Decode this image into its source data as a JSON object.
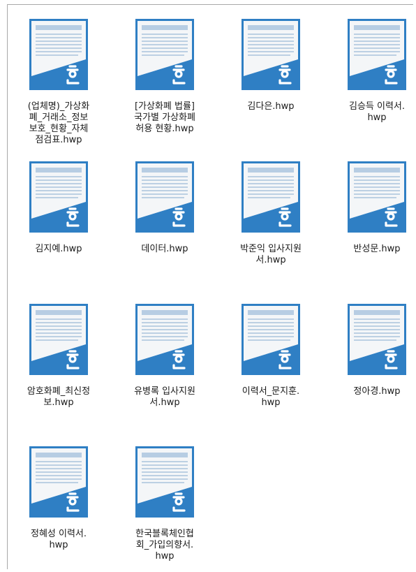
{
  "files": [
    {
      "name": "(업체명)_가상화\n폐_거래소_정보\n보호_현황_자체\n점검표.hwp",
      "icon": "hwp-document-icon"
    },
    {
      "name": "[가상화폐 법률]\n국가별 가상화폐\n허용 현황.hwp",
      "icon": "hwp-document-icon"
    },
    {
      "name": "김다은.hwp",
      "icon": "hwp-document-icon"
    },
    {
      "name": "김승득 이력서.\nhwp",
      "icon": "hwp-document-icon"
    },
    {
      "name": "김지예.hwp",
      "icon": "hwp-document-icon"
    },
    {
      "name": "데이터.hwp",
      "icon": "hwp-document-icon"
    },
    {
      "name": "박준익 입사지원\n서.hwp",
      "icon": "hwp-document-icon"
    },
    {
      "name": "반성문.hwp",
      "icon": "hwp-document-icon"
    },
    {
      "name": "암호화폐_최신정\n보.hwp",
      "icon": "hwp-document-icon"
    },
    {
      "name": "유병록 입사지원\n서.hwp",
      "icon": "hwp-document-icon"
    },
    {
      "name": "이력서_문지훈.\nhwp",
      "icon": "hwp-document-icon"
    },
    {
      "name": "정아경.hwp",
      "icon": "hwp-document-icon"
    },
    {
      "name": "정혜성 이력서.\nhwp",
      "icon": "hwp-document-icon"
    },
    {
      "name": "한국블록체인협\n회_가입의향서.\nhwp",
      "icon": "hwp-document-icon"
    }
  ],
  "colors": {
    "icon_blue": "#2f7fc4",
    "icon_page": "#f4f6f8",
    "icon_lines": "#a9c3dc",
    "icon_header": "#b7cde3"
  }
}
